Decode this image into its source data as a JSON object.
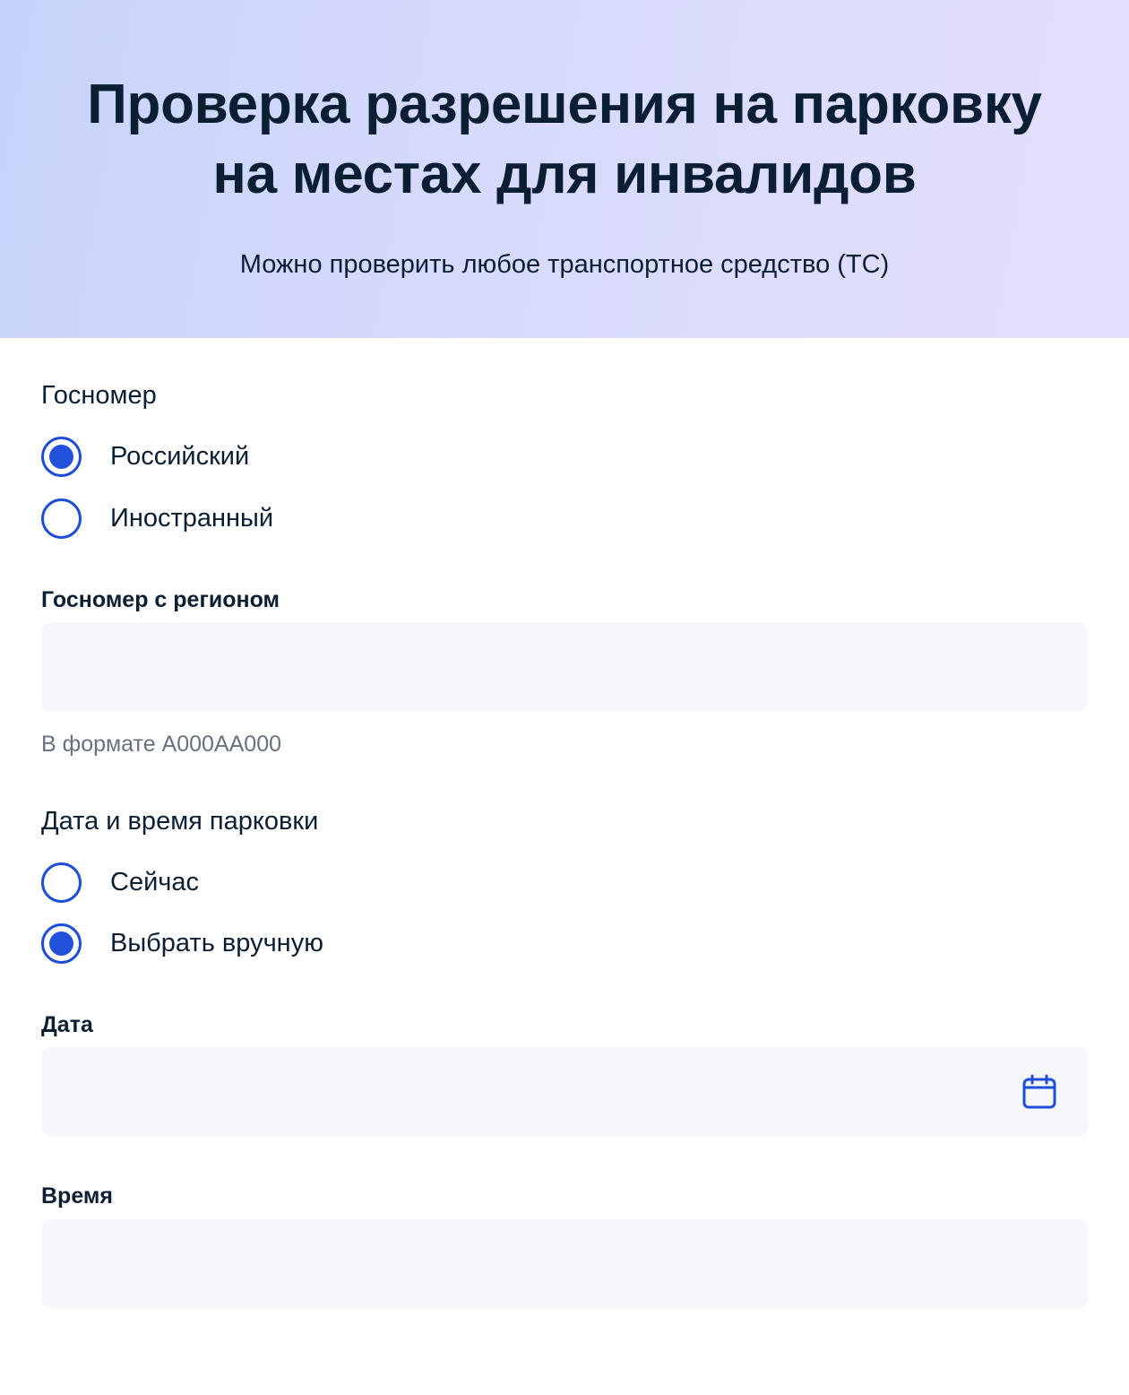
{
  "header": {
    "title": "Проверка разрешения на парковку на местах для инвалидов",
    "subtitle": "Можно проверить любое транспортное средство (ТС)"
  },
  "plate_type": {
    "label": "Госномер",
    "options": [
      {
        "label": "Российский",
        "selected": true
      },
      {
        "label": "Иностранный",
        "selected": false
      }
    ]
  },
  "plate_field": {
    "label": "Госномер с регионом",
    "value": "",
    "hint": "В формате А000АА000"
  },
  "datetime_mode": {
    "label": "Дата и время парковки",
    "options": [
      {
        "label": "Сейчас",
        "selected": false
      },
      {
        "label": "Выбрать вручную",
        "selected": true
      }
    ]
  },
  "date_field": {
    "label": "Дата",
    "value": "",
    "icon": "calendar-icon"
  },
  "time_field": {
    "label": "Время",
    "value": ""
  },
  "colors": {
    "accent": "#2151d9",
    "input_bg": "#f5f7fa",
    "text": "#0b1f33",
    "hint": "#66727f"
  }
}
